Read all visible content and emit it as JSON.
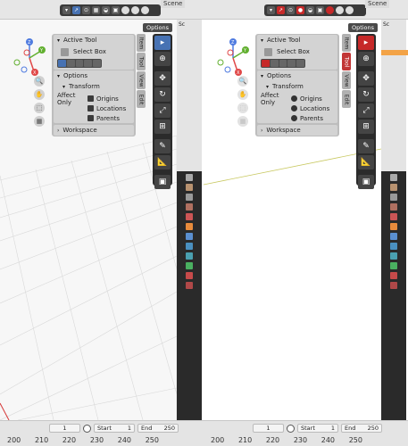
{
  "scene_label": "Scene",
  "options_label": "Options",
  "panel": {
    "active_tool": "Active Tool",
    "select_box": "Select Box",
    "options": "Options",
    "transform": "Transform",
    "affect_only": "Affect Only",
    "origins": "Origins",
    "locations": "Locations",
    "parents": "Parents",
    "workspace": "Workspace"
  },
  "tabs": [
    "Item",
    "Tool",
    "View",
    "Edit"
  ],
  "gizmo": {
    "z": "Z",
    "y": "Y",
    "x": "X"
  },
  "outliner_fragment": "Sc",
  "timeline": {
    "current_frame": "1",
    "start_label": "Start",
    "start": "1",
    "end_label": "End",
    "end": "250",
    "ticks": [
      "200",
      "210",
      "220",
      "230",
      "240",
      "250"
    ]
  },
  "colors": {
    "accent_blue": "#4772b3",
    "accent_red": "#c62929"
  }
}
